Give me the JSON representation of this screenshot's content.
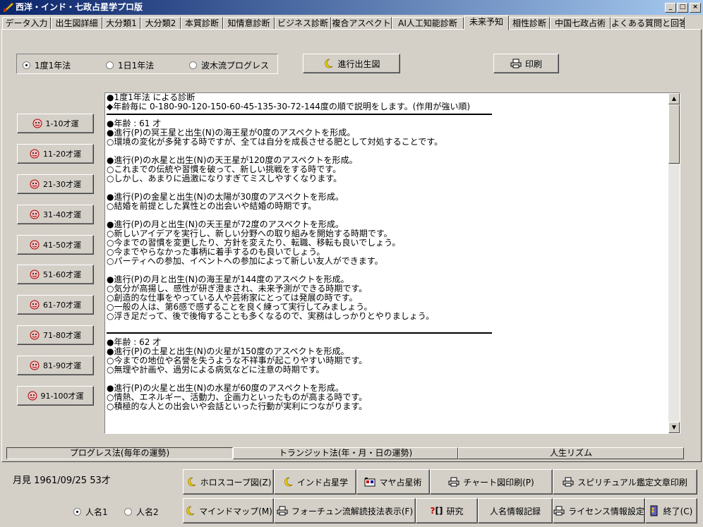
{
  "window": {
    "title": "西洋・インド・七政占星学プロ版"
  },
  "tabs": [
    "データ入力",
    "出生図詳細",
    "大分類1",
    "大分類2",
    "本質診断",
    "知情意診断",
    "ビジネス診断",
    "複合アスペクト",
    "AI人工知能診断",
    "未来予知",
    "相性診断",
    "中国七政占術",
    "よくある質問と回答"
  ],
  "active_tab": "未来予知",
  "method_options": [
    {
      "label": "1度1年法",
      "selected": true
    },
    {
      "label": "1日1年法",
      "selected": false
    },
    {
      "label": "波木流プログレス",
      "selected": false
    }
  ],
  "toolbar": {
    "progress_chart_label": "進行出生図",
    "print_label": "印刷"
  },
  "age_buttons": [
    "1-10才運",
    "11-20才運",
    "21-30才運",
    "31-40才運",
    "41-50才運",
    "51-60才運",
    "61-70才運",
    "71-80才運",
    "81-90才運",
    "91-100才運"
  ],
  "report": {
    "header": [
      "●1度1年法 による診断",
      "◆年齢毎に 0-180-90-120-150-60-45-135-30-72-144度の順で説明をします。(作用が強い順)"
    ],
    "sections": [
      {
        "age": "●年齢 : 61 才",
        "blocks": [
          [
            "●進行(P)の冥王星と出生(N)の海王星が0度のアスペクトを形成。",
            "○環境の変化が多発する時ですが、全ては自分を成長させる肥として対処することです。"
          ],
          [
            "●進行(P)の水星と出生(N)の天王星が120度のアスペクトを形成。",
            "○これまでの伝統や習慣を破って、新しい挑戦をする時です。",
            "○しかし、あまりに過激になりすぎてミスしやすくなります。"
          ],
          [
            "●進行(P)の金星と出生(N)の太陽が30度のアスペクトを形成。",
            "○結婚を前提とした異性との出会いや結婚の時期です。"
          ],
          [
            "●進行(P)の月と出生(N)の天王星が72度のアスペクトを形成。",
            "○新しいアイデアを実行し、新しい分野への取り組みを開始する時期です。",
            "○今までの習慣を変更したり、方針を変えたり、転職、移転も良いでしょう。",
            "○今までやらなかった事柄に着手するのも良いでしょう。",
            "○パーティへの参加、イベントへの参加によって新しい友人ができます。"
          ],
          [
            "●進行(P)の月と出生(N)の海王星が144度のアスペクトを形成。",
            "○気分が高揚し、感性が研ぎ澄まされ、未来予測ができる時期です。",
            "○創造的な仕事をやっている人や芸術家にとっては発展の時です。",
            "○一般の人は、第6感で感ずることを良く練って実行してみましょう。",
            "○浮き足だって、後で後悔することも多くなるので、実務はしっかりとやりましょう。"
          ]
        ]
      },
      {
        "age": "●年齢 : 62 才",
        "blocks": [
          [
            "●進行(P)の土星と出生(N)の火星が150度のアスペクトを形成。",
            "○今までの地位や名誉を失うような不祥事が起こりやすい時期です。",
            "○無理や計画や、過労による病気などに注意の時期です。"
          ],
          [
            "●進行(P)の火星と出生(N)の水星が60度のアスペクトを形成。",
            "○情熱、エネルギー、活動力、企画力といったものが高まる時です。",
            "○積極的な人との出会いや会話といった行動が実利につながります。"
          ]
        ]
      }
    ]
  },
  "mode_tabs": [
    {
      "label": "プログレス法(毎年の運勢)",
      "active": true
    },
    {
      "label": "トランジット法(年・月・日の運勢)",
      "active": false
    },
    {
      "label": "人生リズム",
      "active": false
    }
  ],
  "person": {
    "info": "月見  1961/09/25  53才",
    "name_options": [
      {
        "label": "人名1",
        "selected": true
      },
      {
        "label": "人名2",
        "selected": false
      }
    ]
  },
  "bottom_buttons": {
    "horoscope": "ホロスコープ図(Z)",
    "indian": "インド占星学",
    "maya": "マヤ占星術",
    "chart_print": "チャート図印刷(P)",
    "spiritual_print": "スピリチュアル鑑定文章印刷",
    "mindmap": "マインドマップ(M)",
    "fortune": "フォーチュン流解読技法表示(F)",
    "research": "研究",
    "person_record": "人名情報記録",
    "license": "ライセンス情報設定",
    "exit": "終了(C)"
  }
}
